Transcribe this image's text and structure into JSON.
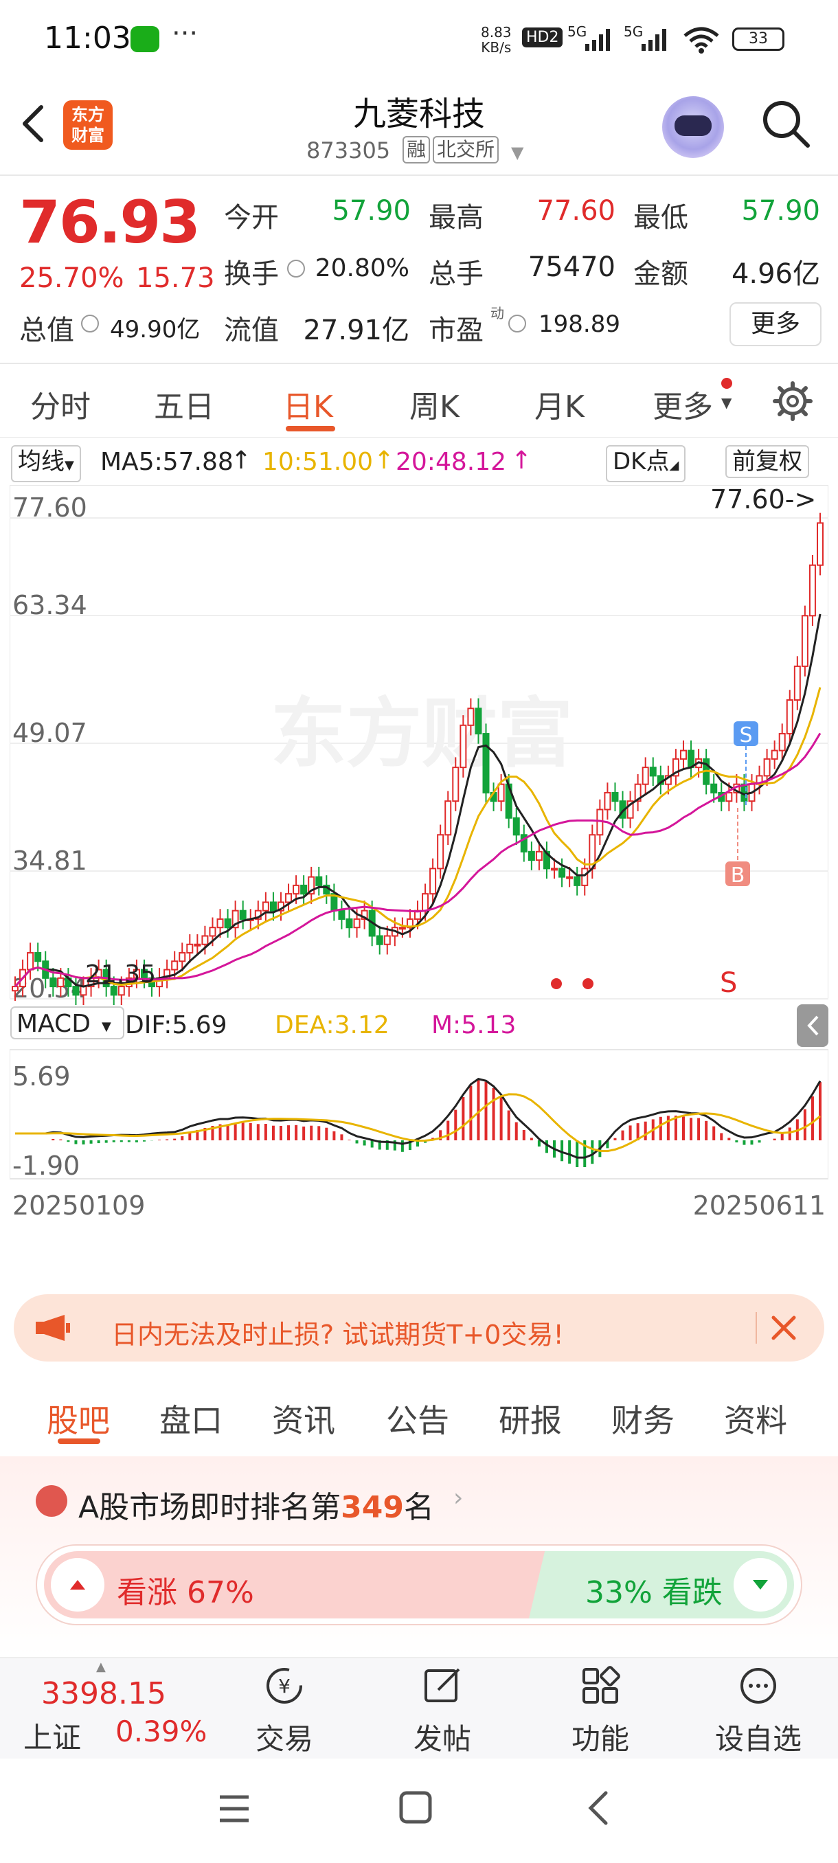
{
  "status_bar": {
    "time": "11:03",
    "dots": "···",
    "net_speed_value": "8.83",
    "net_speed_unit": "KB/s",
    "hd": "HD2",
    "signal1": "5G",
    "signal2": "5G",
    "battery": "33"
  },
  "header": {
    "logo_line1": "东方",
    "logo_line2": "财富",
    "name": "九菱科技",
    "code": "873305",
    "tag_margin": "融",
    "tag_exchange": "北交所"
  },
  "quote": {
    "price": "76.93",
    "change_pct": "25.70%",
    "change_abs": "15.73",
    "open_label": "今开",
    "open": "57.90",
    "high_label": "最高",
    "high": "77.60",
    "low_label": "最低",
    "low": "57.90",
    "turnover_label": "换手",
    "turnover": "20.80%",
    "volume_label": "总手",
    "volume": "75470",
    "amount_label": "金额",
    "amount": "4.96亿",
    "mktcap_label": "总值",
    "mktcap": "49.90亿",
    "float_label": "流值",
    "float_cap": "27.91亿",
    "pe_label": "市盈",
    "pe_sup": "动",
    "pe": "198.89",
    "more": "更多"
  },
  "period_tabs": [
    "分时",
    "五日",
    "日K",
    "周K",
    "月K",
    "更多"
  ],
  "ma_bar": {
    "selector": "均线",
    "ma5": "MA5:57.88",
    "ma10": "10:51.00",
    "ma20": "20:48.12",
    "dk": "DK点",
    "adjust": "前复权"
  },
  "kline": {
    "y_labels": [
      "77.60",
      "63.34",
      "49.07",
      "34.81",
      "20.54"
    ],
    "high_marker": "77.60->",
    "low_marker": "21.35",
    "signal_s": "S",
    "signal_b": "B",
    "signal_s_red": "S",
    "watermark": "东方财富"
  },
  "macd": {
    "selector": "MACD",
    "dif": "DIF:5.69",
    "dea": "DEA:3.12",
    "m": "M:5.13",
    "y_top": "5.69",
    "y_bottom": "-1.90",
    "date_start": "20250109",
    "date_end": "20250611"
  },
  "promo": {
    "text": "日内无法及时止损? 试试期货T+0交易!"
  },
  "section_tabs": [
    "股吧",
    "盘口",
    "资讯",
    "公告",
    "研报",
    "财务",
    "资料"
  ],
  "ranking": {
    "prefix": "A股市场即时排名第",
    "rank": "349",
    "suffix": "名",
    "bull": "看涨 67%",
    "bear": "33% 看跌"
  },
  "toolbar": {
    "index_value": "3398.15",
    "index_name": "上证",
    "index_pct": "0.39%",
    "items": [
      "交易",
      "发帖",
      "功能",
      "设自选"
    ]
  },
  "colors": {
    "up": "#e02b2b",
    "down": "#12a33a",
    "accent": "#e8572a",
    "ma5": "#222222",
    "ma10": "#e8b400",
    "ma20": "#d4169a"
  }
}
